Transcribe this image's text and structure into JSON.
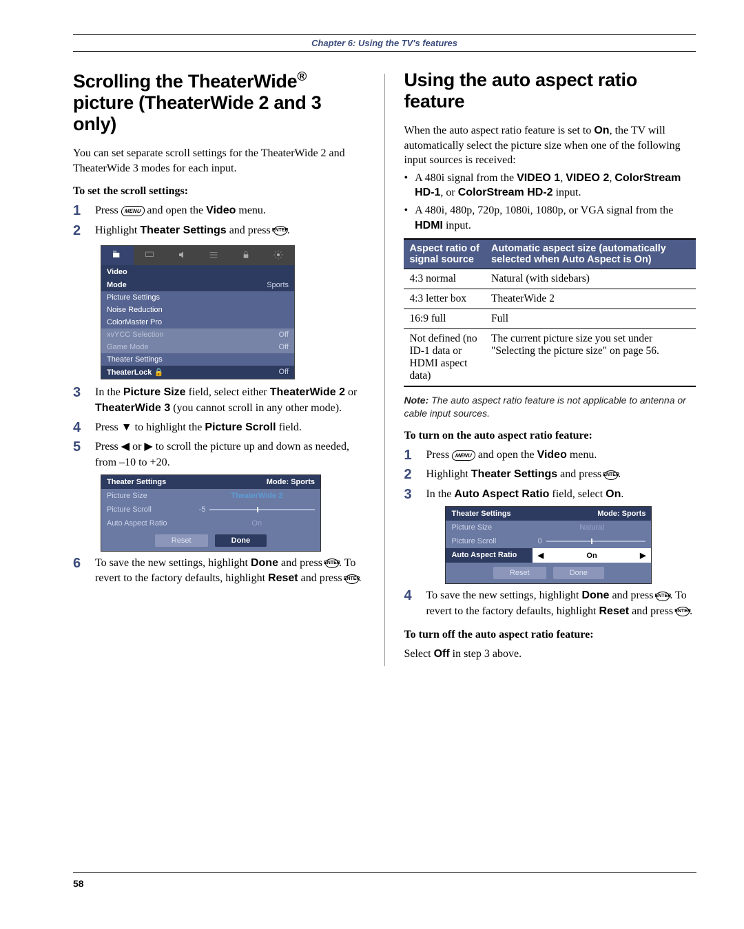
{
  "chapter": "Chapter 6: Using the TV's features",
  "page_number": "58",
  "left": {
    "title_a": "Scrolling the TheaterWide",
    "title_reg": "®",
    "title_b": " picture (TheaterWide 2 and 3 only)",
    "intro": "You can set separate scroll settings for the TheaterWide 2 and TheaterWide 3 modes for each input.",
    "subhead": "To set the scroll settings:",
    "steps": [
      {
        "n": "1",
        "pre": "Press ",
        "key": "MENU",
        "post": " and open the ",
        "bold": "Video",
        "post2": " menu."
      },
      {
        "n": "2",
        "pre": "Highlight ",
        "bold": "Theater Settings",
        "post": " and press ",
        "key": "ENTER",
        "post2": "."
      },
      {
        "n": "3",
        "pre": "In the ",
        "bold": "Picture Size",
        "post": " field, select either ",
        "bold2": "TheaterWide 2",
        "post2": " or ",
        "bold3": "TheaterWide 3",
        "post3": " (you cannot scroll in any other mode)."
      },
      {
        "n": "4",
        "pre": "Press ",
        "tri": "▼",
        "post": " to highlight the ",
        "bold": "Picture Scroll",
        "post2": " field."
      },
      {
        "n": "5",
        "pre": "Press ",
        "tri": "◀",
        "mid": " or ",
        "tri2": "▶",
        "post": " to scroll the picture up and down as needed, from –10 to +20."
      },
      {
        "n": "6",
        "pre": "To save the new settings, highlight ",
        "bold": "Done",
        "post": " and press ",
        "key": "ENTER",
        "post2": ". To revert to the factory defaults, highlight ",
        "bold2": "Reset",
        "post3": " and press ",
        "key2": "ENTER",
        "post4": "."
      }
    ],
    "video_menu": {
      "header": "Video",
      "rows": [
        {
          "label": "Mode",
          "value": "Sports",
          "state": "selected"
        },
        {
          "label": "Picture Settings",
          "value": "",
          "state": ""
        },
        {
          "label": "Noise Reduction",
          "value": "",
          "state": ""
        },
        {
          "label": "ColorMaster Pro",
          "value": "",
          "state": ""
        },
        {
          "label": "xvYCC Selection",
          "value": "Off",
          "state": "disabled"
        },
        {
          "label": "Game Mode",
          "value": "Off",
          "state": "disabled"
        },
        {
          "label": "Theater Settings",
          "value": "",
          "state": ""
        },
        {
          "label": "TheaterLock 🔒",
          "value": "Off",
          "state": "selected"
        }
      ]
    },
    "ts1": {
      "title": "Theater Settings",
      "mode": "Mode: Sports",
      "rows": [
        {
          "label": "Picture Size",
          "value": "TheaterWide 2",
          "sel": true
        },
        {
          "label": "Picture Scroll",
          "slider": "-5"
        },
        {
          "label": "Auto Aspect Ratio",
          "value": "On"
        }
      ],
      "reset": "Reset",
      "done": "Done"
    }
  },
  "right": {
    "title": "Using the auto aspect ratio feature",
    "p1a": "When the auto aspect ratio feature is set to ",
    "p1b": "On",
    "p1c": ", the TV will automatically select the picture size when one of the following input sources is received:",
    "bullets": [
      {
        "pre": "A 480i signal from the ",
        "b1": "VIDEO 1",
        "m1": ", ",
        "b2": "VIDEO 2",
        "m2": ", ",
        "b3": "ColorStream HD-1",
        "m3": ", or ",
        "b4": "ColorStream HD-2",
        "post": " input."
      },
      {
        "pre": "A 480i, 480p, 720p, 1080i, 1080p, or VGA signal from the ",
        "b1": "HDMI",
        "post": " input."
      }
    ],
    "table": {
      "h1": "Aspect ratio of signal source",
      "h2": "Automatic aspect size (automatically selected when Auto Aspect is On)",
      "rows": [
        {
          "c1": "4:3 normal",
          "c2": "Natural (with sidebars)"
        },
        {
          "c1": "4:3 letter box",
          "c2": "TheaterWide 2"
        },
        {
          "c1": "16:9 full",
          "c2": "Full"
        },
        {
          "c1": "Not defined (no ID-1 data or HDMI aspect data)",
          "c2": "The current picture size you set under \"Selecting the picture size\" on page 56."
        }
      ]
    },
    "note_label": "Note:",
    "note": " The auto aspect ratio feature is not applicable to antenna or cable input sources.",
    "subhead_on": "To turn on the auto aspect ratio feature:",
    "steps": [
      {
        "n": "1",
        "pre": "Press ",
        "key": "MENU",
        "post": " and open the ",
        "bold": "Video",
        "post2": " menu."
      },
      {
        "n": "2",
        "pre": "Highlight ",
        "bold": "Theater Settings",
        "post": " and press ",
        "key": "ENTER",
        "post2": "."
      },
      {
        "n": "3",
        "pre": "In the ",
        "bold": "Auto Aspect Ratio",
        "post": " field, select ",
        "bold2": "On",
        "post2": "."
      },
      {
        "n": "4",
        "pre": "To save the new settings, highlight ",
        "bold": "Done",
        "post": " and press ",
        "key": "ENTER",
        "post2": ". To revert to the factory defaults, highlight ",
        "bold2": "Reset",
        "post3": " and press ",
        "key2": "ENTER",
        "post4": "."
      }
    ],
    "ts2": {
      "title": "Theater Settings",
      "mode": "Mode: Sports",
      "rows": [
        {
          "label": "Picture Size",
          "value": "Natural"
        },
        {
          "label": "Picture Scroll",
          "slider": "0"
        },
        {
          "label": "Auto Aspect Ratio",
          "value": "On",
          "active": true
        }
      ],
      "reset": "Reset",
      "done": "Done"
    },
    "subhead_off": "To turn off the auto aspect ratio feature:",
    "off_line_a": "Select ",
    "off_line_b": "Off",
    "off_line_c": " in step 3 above."
  }
}
